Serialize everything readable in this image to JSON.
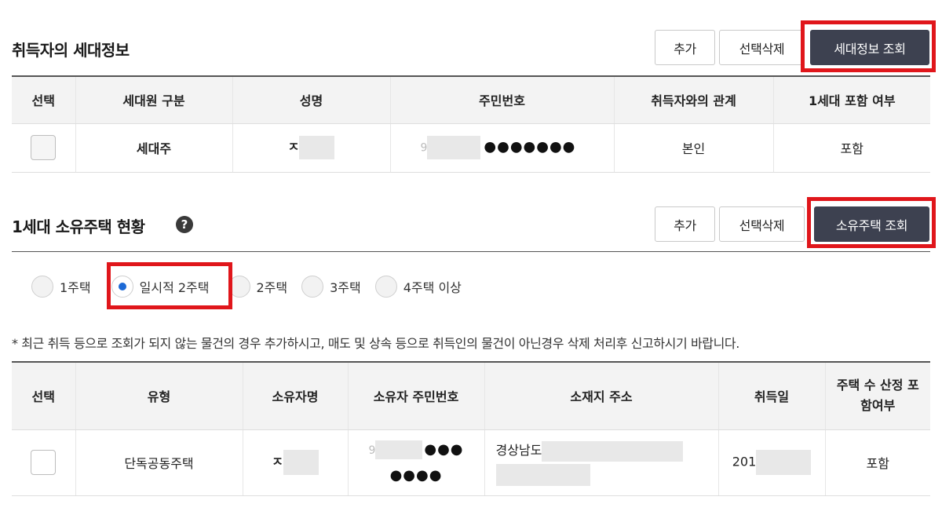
{
  "household": {
    "title": "취득자의 세대정보",
    "buttons": {
      "add": "추가",
      "delete": "선택삭제",
      "lookup": "세대정보 조회"
    },
    "columns": [
      "선택",
      "세대원 구분",
      "성명",
      "주민번호",
      "취득자와의 관계",
      "1세대 포함 여부"
    ],
    "rows": [
      {
        "type": "세대주",
        "name": "ㅈ",
        "id_prefix": "9",
        "id_masked": "●●●●●●●",
        "relation": "본인",
        "included": "포함"
      }
    ]
  },
  "housing": {
    "title": "1세대 소유주택 현황",
    "help": "?",
    "buttons": {
      "add": "추가",
      "delete": "선택삭제",
      "lookup": "소유주택 조회"
    },
    "options": [
      "1주택",
      "일시적 2주택",
      "2주택",
      "3주택",
      "4주택 이상"
    ],
    "selected_option": "일시적 2주택",
    "notice": "* 최근 취득 등으로 조회가 되지 않는 물건의 경우 추가하시고, 매도 및 상속 등으로 취득인의 물건이 아닌경우 삭제 처리후 신고하시기 바랍니다.",
    "columns": [
      "선택",
      "유형",
      "소유자명",
      "소유자 주민번호",
      "소재지 주소",
      "취득일",
      "주택 수 산정 포함여부"
    ],
    "rows": [
      {
        "type": "단독공동주택",
        "owner": "ㅈ",
        "id_prefix": "9",
        "id_masked_1": "●●●",
        "id_masked_2": "●●●●",
        "address": "경상남도",
        "acquired": "201",
        "included": "포함"
      }
    ]
  }
}
